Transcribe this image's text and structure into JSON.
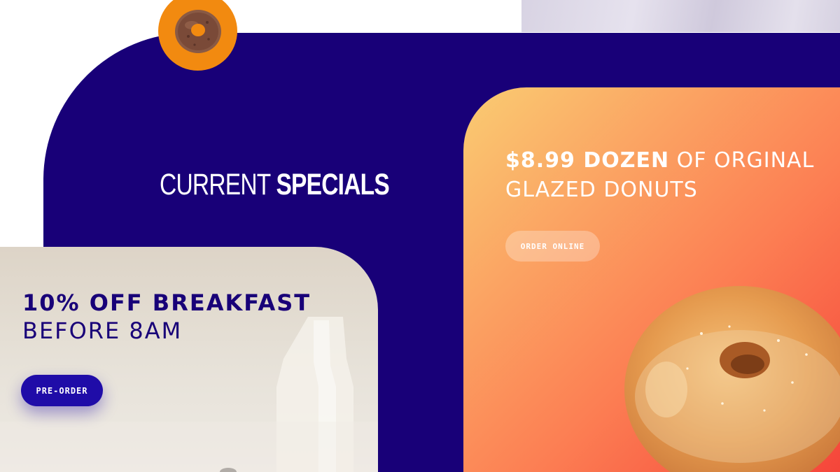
{
  "colors": {
    "navy": "#180078",
    "orange_badge": "#f28a10",
    "button_blue": "#1f0ca8",
    "gradient_start": "#f9cc72",
    "gradient_end": "#f5453a",
    "cream": "#ddd4c7"
  },
  "icons": {
    "badge": "chocolate-donut-icon",
    "breakfast_background": "milk-bottle-icon",
    "glazed_image": "glazed-donut-icon"
  },
  "specials": {
    "heading_light": "CURRENT",
    "heading_bold": "SPECIALS"
  },
  "breakfast_offer": {
    "title": "10% OFF BREAKFAST",
    "subtitle": "BEFORE 8AM",
    "button_label": "PRE-ORDER"
  },
  "glazed_offer": {
    "title_bold": "$8.99 DOZEN",
    "title_light": "OF ORGINAL",
    "subtitle": "GLAZED DONUTS",
    "button_label": "ORDER ONLINE"
  }
}
